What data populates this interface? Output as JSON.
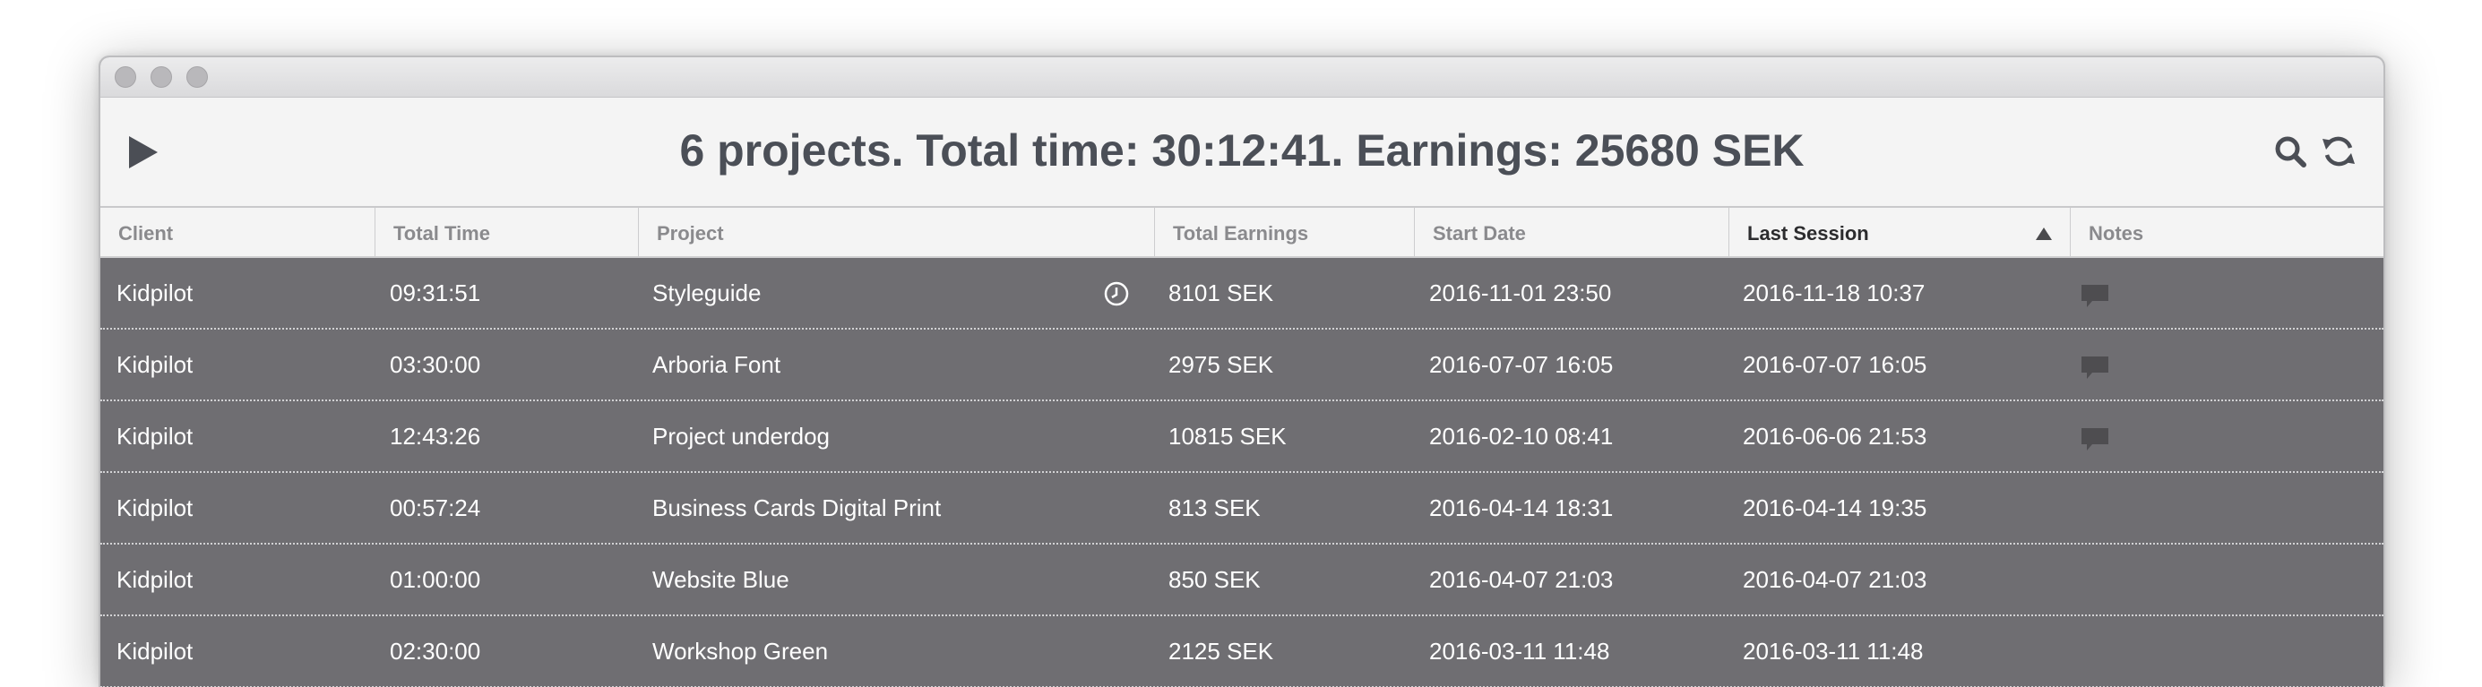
{
  "toolbar": {
    "summary": "6 projects. Total time: 30:12:41. Earnings: 25680 SEK",
    "icons": [
      "play-icon",
      "search-icon",
      "refresh-icon"
    ]
  },
  "columns": {
    "client": "Client",
    "total_time": "Total Time",
    "project": "Project",
    "total_earnings": "Total Earnings",
    "start_date": "Start Date",
    "last_session": "Last Session",
    "notes": "Notes"
  },
  "sort": {
    "column": "Last Session",
    "direction": "ascending-indicator"
  },
  "colors": {
    "row_background": "#6f6e72",
    "toolbar_background": "#f4f4f4",
    "header_text": "#8a8a8d",
    "active_header_text": "#2c2c2e",
    "row_text": "#ffffff"
  },
  "rows": [
    {
      "client": "Kidpilot",
      "total_time": "09:31:51",
      "project": "Styleguide",
      "earnings": "8101 SEK",
      "start_date": "2016-11-01 23:50",
      "last_session": "2016-11-18 10:37",
      "has_timer": true,
      "has_note": true
    },
    {
      "client": "Kidpilot",
      "total_time": "03:30:00",
      "project": "Arboria Font",
      "earnings": "2975 SEK",
      "start_date": "2016-07-07 16:05",
      "last_session": "2016-07-07 16:05",
      "has_timer": false,
      "has_note": true
    },
    {
      "client": "Kidpilot",
      "total_time": "12:43:26",
      "project": "Project underdog",
      "earnings": "10815 SEK",
      "start_date": "2016-02-10 08:41",
      "last_session": "2016-06-06 21:53",
      "has_timer": false,
      "has_note": true
    },
    {
      "client": "Kidpilot",
      "total_time": "00:57:24",
      "project": "Business Cards Digital Print",
      "earnings": "813 SEK",
      "start_date": "2016-04-14 18:31",
      "last_session": "2016-04-14 19:35",
      "has_timer": false,
      "has_note": false
    },
    {
      "client": "Kidpilot",
      "total_time": "01:00:00",
      "project": "Website Blue",
      "earnings": "850 SEK",
      "start_date": "2016-04-07 21:03",
      "last_session": "2016-04-07 21:03",
      "has_timer": false,
      "has_note": false
    },
    {
      "client": "Kidpilot",
      "total_time": "02:30:00",
      "project": "Workshop Green",
      "earnings": "2125 SEK",
      "start_date": "2016-03-11 11:48",
      "last_session": "2016-03-11 11:48",
      "has_timer": false,
      "has_note": false
    }
  ]
}
